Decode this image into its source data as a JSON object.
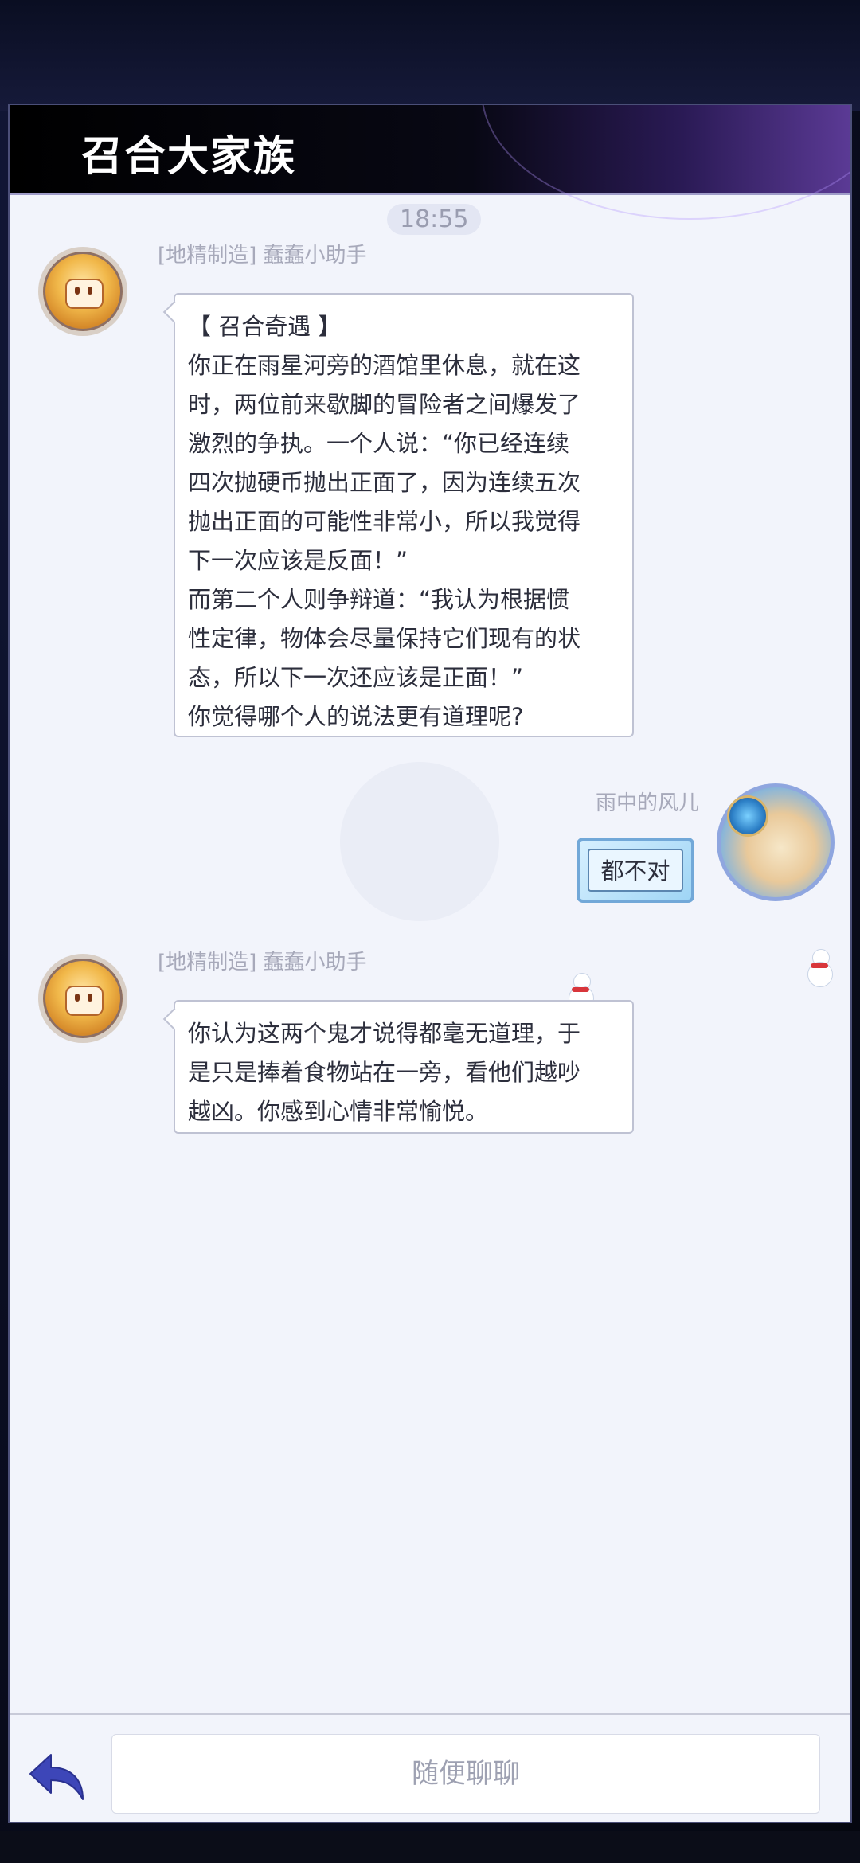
{
  "header": {
    "title": "召合大家族"
  },
  "chat": {
    "timestamp": "18:55",
    "messages": [
      {
        "sender": "[地精制造] 蠢蠢小助手",
        "avatar_icon": "gnome-robot-icon",
        "lines": [
          "【 召合奇遇 】",
          "你正在雨星河旁的酒馆里休息，就在这",
          "时，两位前来歇脚的冒险者之间爆发了",
          "激烈的争执。一个人说：“你已经连续",
          "四次抛硬币抛出正面了，因为连续五次",
          "抛出正面的可能性非常小，所以我觉得",
          "下一次应该是反面！”",
          "而第二个人则争辩道：“我认为根据惯",
          "性定律，物体会尽量保持它们现有的状",
          "态，所以下一次还应该是正面！”",
          "你觉得哪个人的说法更有道理呢?"
        ]
      },
      {
        "sender": "雨中的风儿",
        "avatar_icon": "user-hero-avatar-icon",
        "text": "都不对"
      },
      {
        "sender": "[地精制造] 蠢蠢小助手",
        "avatar_icon": "gnome-robot-icon",
        "lines": [
          "你认为这两个鬼才说得都毫无道理，于",
          "是只是捧着食物站在一旁，看他们越吵",
          "越凶。你感到心情非常愉悦。"
        ]
      }
    ]
  },
  "footer": {
    "back_icon": "back-arrow-icon",
    "input_placeholder": "随便聊聊"
  },
  "colors": {
    "panel_bg": "#f2f4fb",
    "header_bg": "#000000",
    "back_arrow": "#3d46b8",
    "bubble_border": "#bfc2d3",
    "sender_text": "#a7a9ba"
  }
}
